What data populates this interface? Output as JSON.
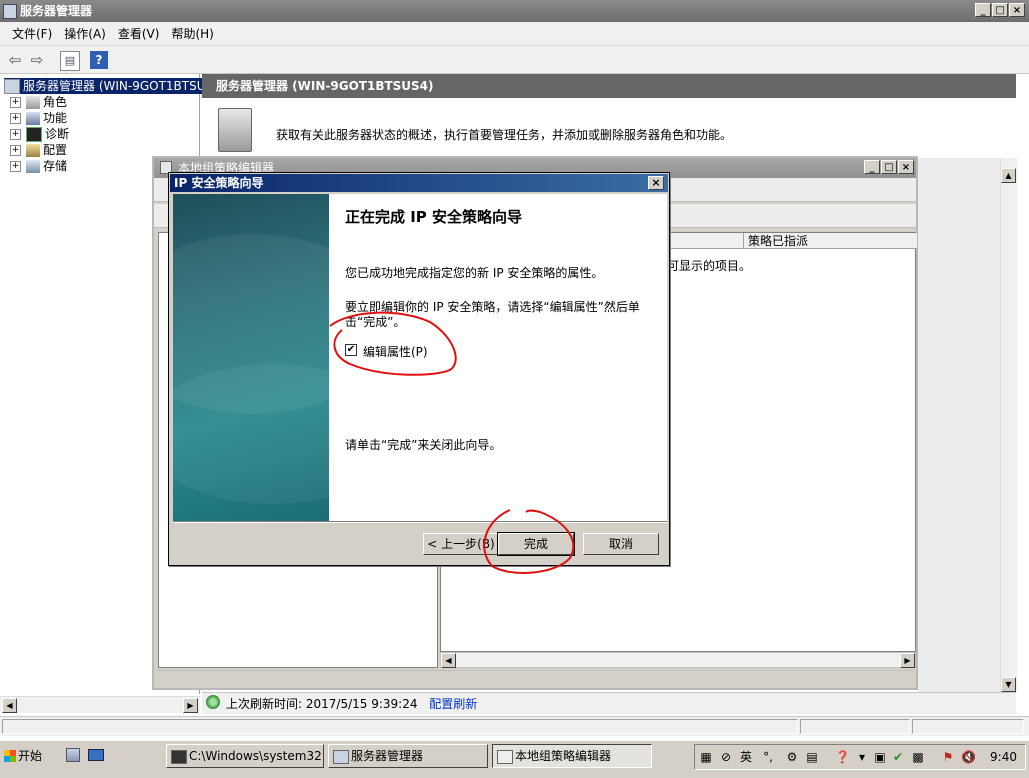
{
  "server_manager": {
    "title": "服务器管理器",
    "menu": [
      "文件(F)",
      "操作(A)",
      "查看(V)",
      "帮助(H)"
    ],
    "tree": {
      "root": "服务器管理器 (WIN-9GOT1BTSUS",
      "items": [
        "角色",
        "功能",
        "诊断",
        "配置",
        "存储"
      ]
    },
    "panel_title": "服务器管理器 (WIN-9GOT1BTSUS4)",
    "description": "获取有关此服务器状态的概述，执行首要管理任务，并添加或删除服务器角色和功能。",
    "status": {
      "last_refresh": "上次刷新时间: 2017/5/15 9:39:24",
      "refresh_link": "配置刷新"
    }
  },
  "gpe": {
    "title": "本地组策略编辑器",
    "column_policy_assigned": "策略已指派",
    "empty_text": "可显示的项目。"
  },
  "wizard": {
    "title": "IP 安全策略向导",
    "heading": "正在完成 IP 安全策略向导",
    "text1": "您已成功地完成指定您的新 IP 安全策略的属性。",
    "text2": "要立即编辑你的 IP 安全策略，请选择“编辑属性”然后单击“完成”。",
    "checkbox_label": "编辑属性(P)",
    "checkbox_checked": true,
    "text3": "请单击“完成”来关闭此向导。",
    "buttons": {
      "back": "< 上一步(B)",
      "finish": "完成",
      "cancel": "取消"
    }
  },
  "taskbar": {
    "start": "开始",
    "tasks": [
      "C:\\Windows\\system32...",
      "服务器管理器",
      "本地组策略编辑器"
    ],
    "ime": "英",
    "clock": "9:40"
  },
  "colors": {
    "title_active": "#0a246a",
    "annotation": "#e01010",
    "link": "#0033cc"
  }
}
